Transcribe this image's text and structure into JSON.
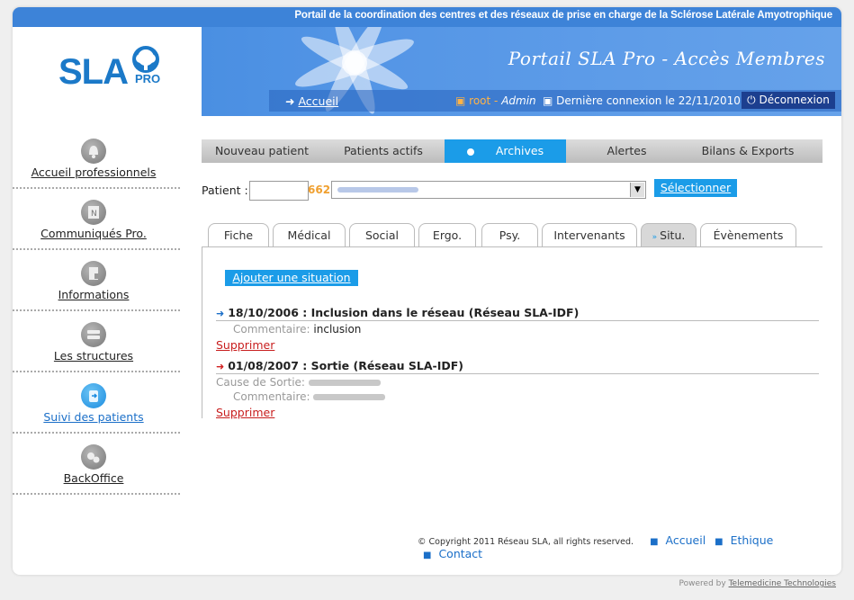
{
  "header": {
    "tagline": "Portail de la coordination des centres et des réseaux de prise en charge de la Sclérose Latérale Amyotrophique",
    "logo_text": "SLA",
    "logo_sub": "PRO",
    "portal_title": "Portail SLA Pro - Accès Membres",
    "home_label": "Accueil",
    "user_name": "root",
    "user_role": "Admin",
    "last_login": "Dernière connexion le 22/11/2010",
    "logout_label": "Déconnexion"
  },
  "sidebar": {
    "items": [
      {
        "label": "Accueil professionnels",
        "icon": "bell-icon"
      },
      {
        "label": "Communiqués Pro.",
        "icon": "news-icon"
      },
      {
        "label": "Informations",
        "icon": "document-icon"
      },
      {
        "label": "Les structures",
        "icon": "building-icon"
      },
      {
        "label": "Suivi des patients",
        "icon": "patient-icon"
      },
      {
        "label": "BackOffice",
        "icon": "gears-icon"
      }
    ]
  },
  "main_tabs": [
    "Nouveau patient",
    "Patients actifs",
    "Archives",
    "Alertes",
    "Bilans & Exports"
  ],
  "patient": {
    "label": "Patient :",
    "id_value": "",
    "number": "662",
    "select_button": "Sélectionner"
  },
  "sub_tabs": [
    "Fiche",
    "Médical",
    "Social",
    "Ergo.",
    "Psy.",
    "Intervenants",
    "Situ.",
    "Évènements"
  ],
  "add_button": "Ajouter une situation",
  "situations": [
    {
      "title": "18/10/2006 : Inclusion dans le réseau (Réseau SLA-IDF)",
      "comment_key": "Commentaire:",
      "comment_value": "inclusion",
      "delete_label": "Supprimer",
      "arrow_color": "#1b6fc8"
    },
    {
      "title": "01/08/2007 : Sortie (Réseau SLA-IDF)",
      "cause_key": "Cause de Sortie:",
      "comment_key": "Commentaire:",
      "delete_label": "Supprimer",
      "arrow_color": "#d02020"
    }
  ],
  "footer": {
    "copyright": "© Copyright 2011 Réseau SLA, all rights reserved.",
    "links": [
      "Accueil",
      "Ethique",
      "Contact"
    ],
    "powered_prefix": "Powered by",
    "powered_link": "Telemedicine Technologies"
  },
  "colors": {
    "accent": "#1b9ce8",
    "brand": "#1b79c8",
    "banner": "#4a8fe2"
  }
}
